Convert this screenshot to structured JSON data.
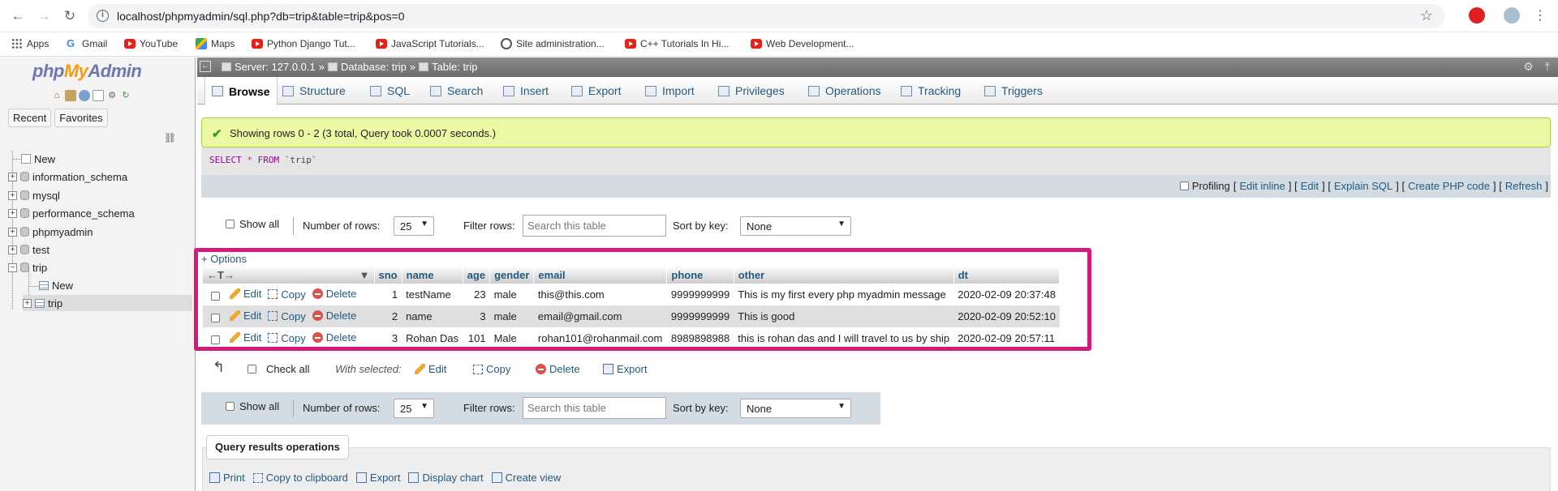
{
  "browser": {
    "url": "localhost/phpmyadmin/sql.php?db=trip&table=trip&pos=0",
    "bookmarks": [
      {
        "label": "Apps",
        "icon": "apps-grid-icon"
      },
      {
        "label": "Gmail",
        "icon": "google-icon"
      },
      {
        "label": "YouTube",
        "icon": "youtube-icon"
      },
      {
        "label": "Maps",
        "icon": "maps-icon"
      },
      {
        "label": "Python Django Tut...",
        "icon": "youtube-icon"
      },
      {
        "label": "JavaScript Tutorials...",
        "icon": "youtube-icon"
      },
      {
        "label": "Site administration...",
        "icon": "globe-icon"
      },
      {
        "label": "C++ Tutorials In Hi...",
        "icon": "youtube-icon"
      },
      {
        "label": "Web Development...",
        "icon": "youtube-icon"
      }
    ]
  },
  "sidebar": {
    "logo_php": "php",
    "logo_my": "My",
    "logo_admin": "Admin",
    "tabs": [
      "Recent",
      "Favorites"
    ],
    "tree": [
      {
        "label": "New",
        "type": "new"
      },
      {
        "label": "information_schema",
        "type": "db"
      },
      {
        "label": "mysql",
        "type": "db"
      },
      {
        "label": "performance_schema",
        "type": "db"
      },
      {
        "label": "phpmyadmin",
        "type": "db"
      },
      {
        "label": "test",
        "type": "db"
      },
      {
        "label": "trip",
        "type": "db-open"
      },
      {
        "label": "New",
        "type": "new-child"
      },
      {
        "label": "trip",
        "type": "table-child"
      }
    ]
  },
  "breadcrumb": {
    "server": "Server: 127.0.0.1",
    "database": "Database: trip",
    "table": "Table: trip"
  },
  "tabs": [
    "Browse",
    "Structure",
    "SQL",
    "Search",
    "Insert",
    "Export",
    "Import",
    "Privileges",
    "Operations",
    "Tracking",
    "Triggers"
  ],
  "message": "Showing rows 0 - 2 (3 total, Query took 0.0007 seconds.)",
  "sql": {
    "kw": "SELECT",
    "op": "*",
    "from": "FROM",
    "ident": "`trip`"
  },
  "profiling": {
    "label": "Profiling",
    "links": [
      "Edit inline",
      "Edit",
      "Explain SQL",
      "Create PHP code",
      "Refresh"
    ]
  },
  "nav": {
    "show_all": "Show all",
    "num_rows_label": "Number of rows:",
    "num_rows_value": "25",
    "filter_label": "Filter rows:",
    "filter_placeholder": "Search this table",
    "sort_label": "Sort by key:",
    "sort_value": "None"
  },
  "options_link": "+ Options",
  "columns": [
    "sno",
    "name",
    "age",
    "gender",
    "email",
    "phone",
    "other",
    "dt"
  ],
  "actions": {
    "edit": "Edit",
    "copy": "Copy",
    "delete": "Delete"
  },
  "rows": [
    {
      "sno": "1",
      "name": "testName",
      "age": "23",
      "gender": "male",
      "email": "this@this.com",
      "phone": "9999999999",
      "other": "This is my first every php myadmin message",
      "dt": "2020-02-09 20:37:48"
    },
    {
      "sno": "2",
      "name": "name",
      "age": "3",
      "gender": "male",
      "email": "email@gmail.com",
      "phone": "9999999999",
      "other": "This is good",
      "dt": "2020-02-09 20:52:10"
    },
    {
      "sno": "3",
      "name": "Rohan Das",
      "age": "101",
      "gender": "Male",
      "email": "rohan101@rohanmail.com",
      "phone": "8989898988",
      "other": "this is rohan das and I will travel to us by ship",
      "dt": "2020-02-09 20:57:11"
    }
  ],
  "bulk": {
    "check_all": "Check all",
    "with_selected": "With selected:",
    "edit": "Edit",
    "copy": "Copy",
    "delete": "Delete",
    "export": "Export"
  },
  "query_ops": {
    "title": "Query results operations",
    "links": [
      "Print",
      "Copy to clipboard",
      "Export",
      "Display chart",
      "Create view"
    ]
  },
  "colors": {
    "accent_link": "#235a81",
    "highlight": "#d6197a",
    "success_bg": "#ebf8a4"
  }
}
